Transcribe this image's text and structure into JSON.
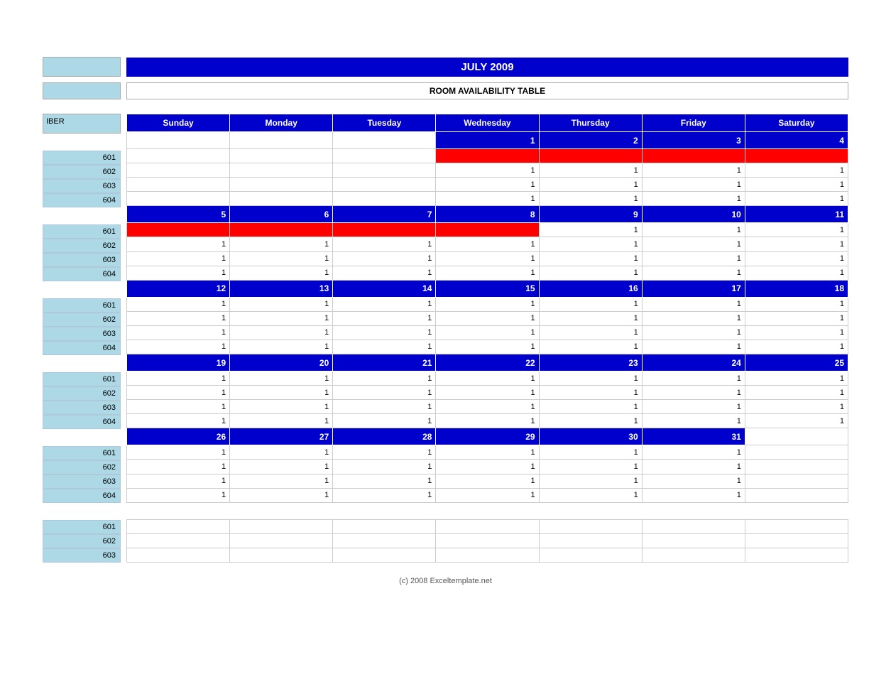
{
  "title": "JULY 2009",
  "subtitle": "ROOM AVAILABILITY TABLE",
  "days": [
    "Sunday",
    "Monday",
    "Tuesday",
    "Wednesday",
    "Thursday",
    "Friday",
    "Saturday"
  ],
  "sidebarLabel": "IBER",
  "rooms": [
    "601",
    "602",
    "603",
    "604"
  ],
  "weeks": [
    {
      "dates": [
        "",
        "",
        "",
        "1",
        "2",
        "3",
        "4"
      ],
      "roomData": {
        "601": [
          "",
          "",
          "",
          "red",
          "red",
          "red",
          "red"
        ],
        "602": [
          "",
          "",
          "",
          "1",
          "1",
          "1",
          "1"
        ],
        "603": [
          "",
          "",
          "",
          "1",
          "1",
          "1",
          "1"
        ],
        "604": [
          "",
          "",
          "",
          "1",
          "1",
          "1",
          "1"
        ]
      }
    },
    {
      "dates": [
        "5",
        "6",
        "7",
        "8",
        "9",
        "10",
        "11"
      ],
      "roomData": {
        "601": [
          "red",
          "red",
          "red",
          "red",
          "1",
          "1",
          "1"
        ],
        "602": [
          "1",
          "1",
          "1",
          "1",
          "1",
          "1",
          "1"
        ],
        "603": [
          "1",
          "1",
          "1",
          "1",
          "1",
          "1",
          "1"
        ],
        "604": [
          "1",
          "1",
          "1",
          "1",
          "1",
          "1",
          "1"
        ]
      }
    },
    {
      "dates": [
        "12",
        "13",
        "14",
        "15",
        "16",
        "17",
        "18"
      ],
      "roomData": {
        "601": [
          "1",
          "1",
          "1",
          "1",
          "1",
          "1",
          "1"
        ],
        "602": [
          "1",
          "1",
          "1",
          "1",
          "1",
          "1",
          "1"
        ],
        "603": [
          "1",
          "1",
          "1",
          "1",
          "1",
          "1",
          "1"
        ],
        "604": [
          "1",
          "1",
          "1",
          "1",
          "1",
          "1",
          "1"
        ]
      }
    },
    {
      "dates": [
        "19",
        "20",
        "21",
        "22",
        "23",
        "24",
        "25"
      ],
      "roomData": {
        "601": [
          "1",
          "1",
          "1",
          "1",
          "1",
          "1",
          "1"
        ],
        "602": [
          "1",
          "1",
          "1",
          "1",
          "1",
          "1",
          "1"
        ],
        "603": [
          "1",
          "1",
          "1",
          "1",
          "1",
          "1",
          "1"
        ],
        "604": [
          "1",
          "1",
          "1",
          "1",
          "1",
          "1",
          "1"
        ]
      }
    },
    {
      "dates": [
        "26",
        "27",
        "28",
        "29",
        "30",
        "31",
        ""
      ],
      "roomData": {
        "601": [
          "1",
          "1",
          "1",
          "1",
          "1",
          "1",
          ""
        ],
        "602": [
          "1",
          "1",
          "1",
          "1",
          "1",
          "1",
          ""
        ],
        "603": [
          "1",
          "1",
          "1",
          "1",
          "1",
          "1",
          ""
        ],
        "604": [
          "1",
          "1",
          "1",
          "1",
          "1",
          "1",
          ""
        ]
      }
    }
  ],
  "extraRooms": [
    "601",
    "602",
    "603"
  ],
  "footer": "(c) 2008 Exceltemplate.net"
}
